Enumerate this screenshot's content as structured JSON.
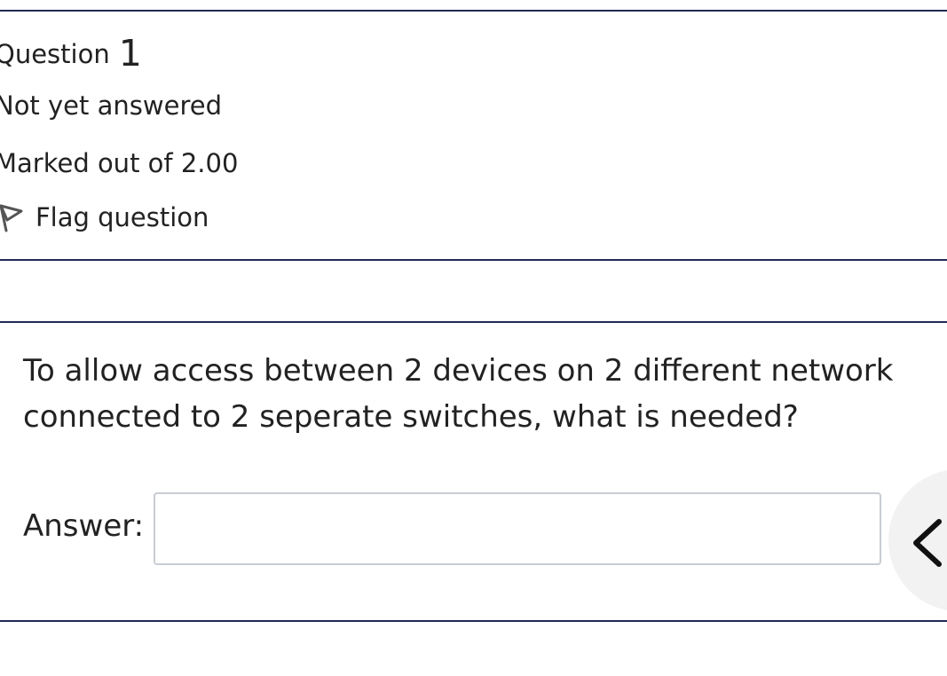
{
  "question_info": {
    "label": "Question",
    "number": "1",
    "state": "Not yet answered",
    "grade": "Marked out of 2.00",
    "flag_label": "Flag question"
  },
  "question": {
    "text": "To allow access between 2 devices on 2 different network connected to 2 seperate switches, what is needed?",
    "answer_label": "Answer:",
    "answer_value": "",
    "answer_placeholder": ""
  },
  "icons": {
    "flag": "flag-icon",
    "drawer_toggle": "chevron-left-icon"
  },
  "colors": {
    "rule": "#1f2a55",
    "text": "#222222",
    "input_border": "#c8ccd3",
    "drawer_bg": "#f2f2f2"
  }
}
